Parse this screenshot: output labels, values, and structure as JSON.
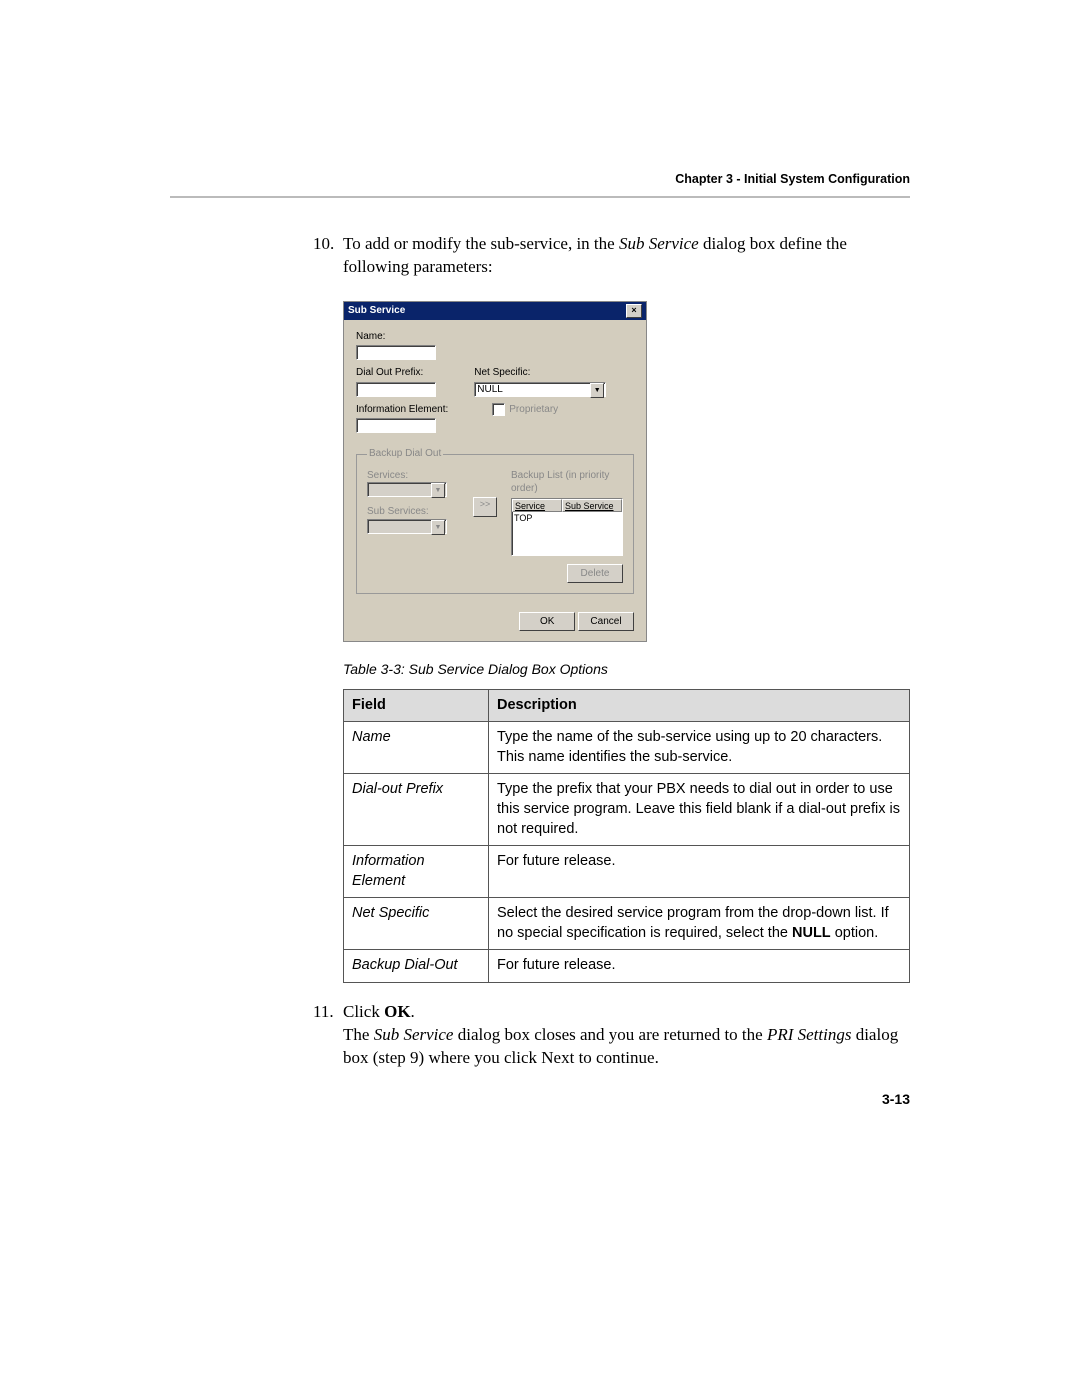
{
  "header": {
    "chapter": "Chapter 3 - Initial System Configuration"
  },
  "step10": {
    "num": "10.",
    "lead1": "To add or modify the sub-service, in the ",
    "em1": "Sub Service",
    "lead2": " dialog box define the following parameters:"
  },
  "dialog": {
    "title": "Sub Service",
    "close": "×",
    "name_label": "Name:",
    "name_value": "",
    "dial_out_label": "Dial Out Prefix:",
    "dial_out_value": "",
    "net_specific_label": "Net Specific:",
    "net_specific_value": "NULL",
    "info_elem_label": "Information Element:",
    "info_elem_value": "",
    "proprietary_label": "Proprietary",
    "backup_legend": "Backup Dial Out",
    "services_label": "Services:",
    "sub_services_label": "Sub Services:",
    "arrow": ">>",
    "backup_list_label": "Backup List (in priority order)",
    "col_service": "Service",
    "col_subservice": "Sub Service",
    "row_top": "TOP",
    "delete": "Delete",
    "ok": "OK",
    "cancel": "Cancel"
  },
  "caption": "Table 3-3: Sub Service Dialog Box Options",
  "table": {
    "hdr_field": "Field",
    "hdr_desc": "Description",
    "rows": [
      {
        "f": "Name",
        "d": "Type the name of the sub-service using up to 20 characters. This name identifies the sub-service."
      },
      {
        "f": "Dial-out Prefix",
        "d": "Type the prefix that your PBX needs to dial out in order to use this service program. Leave this field blank if a dial-out prefix is not required."
      },
      {
        "f": "Information Element",
        "d": "For future release."
      },
      {
        "f": "Net Specific",
        "d_pre": "Select the desired service program from the drop-down list. If no special specification is required, select the ",
        "d_bold": "NULL",
        "d_post": " option."
      },
      {
        "f": "Backup Dial-Out",
        "d": "For future release."
      }
    ]
  },
  "step11": {
    "num": "11.",
    "click": "Click ",
    "ok": "OK",
    "dot": ".",
    "p1a": "The ",
    "p1b": "Sub Service",
    "p1c": " dialog box closes and you are returned to the ",
    "p1d": "PRI Settings",
    "p1e": " dialog box (step 9) where you click Next to continue."
  },
  "page_number": "3-13"
}
